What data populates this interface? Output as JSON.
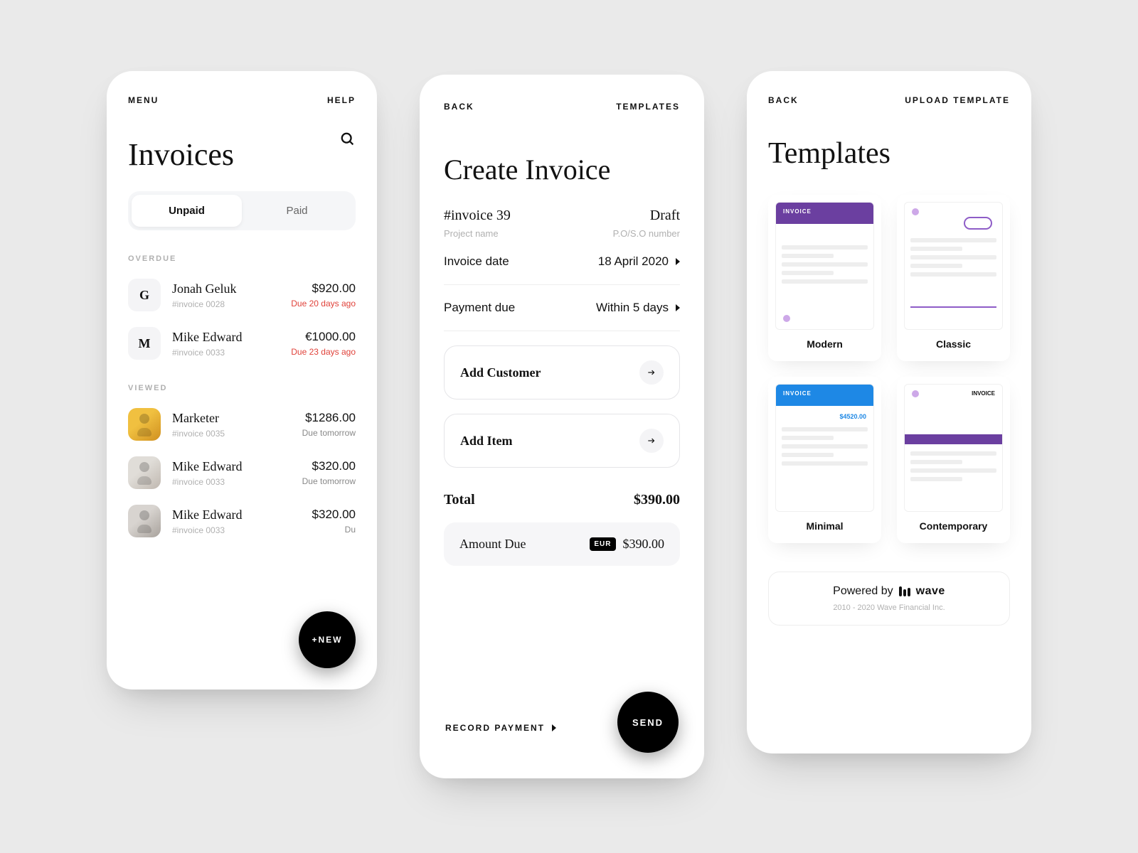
{
  "invoices": {
    "topbar": {
      "menu": "MENU",
      "help": "HELP"
    },
    "title": "Invoices",
    "tabs": {
      "unpaid": "Unpaid",
      "paid": "Paid"
    },
    "sections": {
      "overdue": "OVERDUE",
      "viewed": "VIEWED"
    },
    "overdue": [
      {
        "initial": "G",
        "name": "Jonah Geluk",
        "ref": "#invoice 0028",
        "amount": "$920.00",
        "due": "Due 20 days ago"
      },
      {
        "initial": "M",
        "name": "Mike Edward",
        "ref": "#invoice 0033",
        "amount": "€1000.00",
        "due": "Due 23 days ago"
      }
    ],
    "viewed": [
      {
        "name": "Marketer",
        "ref": "#invoice 0035",
        "amount": "$1286.00",
        "due": "Due tomorrow"
      },
      {
        "name": "Mike Edward",
        "ref": "#invoice 0033",
        "amount": "$320.00",
        "due": "Due tomorrow"
      },
      {
        "name": "Mike Edward",
        "ref": "#invoice 0033",
        "amount": "$320.00",
        "due": "Du"
      }
    ],
    "fab": "+NEW"
  },
  "create": {
    "topbar": {
      "back": "BACK",
      "templates": "TEMPLATES"
    },
    "title": "Create Invoice",
    "meta": {
      "ref": "#invoice 39",
      "status": "Draft",
      "project_label": "Project name",
      "po_label": "P.O/S.O number"
    },
    "rows": {
      "date_label": "Invoice date",
      "date_value": "18 April 2020",
      "due_label": "Payment due",
      "due_value": "Within 5 days"
    },
    "buttons": {
      "add_customer": "Add Customer",
      "add_item": "Add Item"
    },
    "total": {
      "label": "Total",
      "value": "$390.00"
    },
    "due": {
      "label": "Amount Due",
      "currency": "EUR",
      "value": "$390.00"
    },
    "footer": {
      "record": "RECORD PAYMENT",
      "send": "SEND"
    }
  },
  "templates": {
    "topbar": {
      "back": "BACK",
      "upload": "UPLOAD TEMPLATE"
    },
    "title": "Templates",
    "items": [
      {
        "name": "Modern"
      },
      {
        "name": "Classic"
      },
      {
        "name": "Minimal"
      },
      {
        "name": "Contemporary"
      }
    ],
    "thumbs": {
      "invoice_word": "INVOICE",
      "minimal_amount": "$4520.00"
    },
    "powered": {
      "prefix": "Powered by",
      "brand": "wave",
      "sub": "2010 - 2020 Wave Financial Inc."
    }
  }
}
